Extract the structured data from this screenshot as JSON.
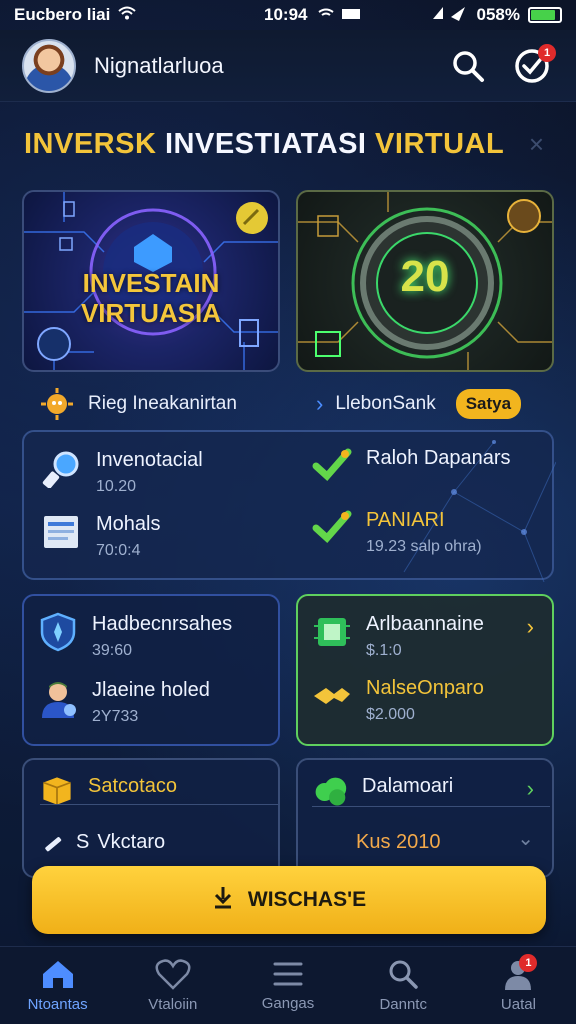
{
  "status_bar": {
    "carrier": "Eucbero liai",
    "time": "10:94",
    "battery_text": "058%",
    "battery_level": 0.85,
    "battery_color": "#47d14a"
  },
  "header": {
    "username": "Nignatlarluoa",
    "search_icon": "search-icon",
    "check_icon": "check-circle-icon",
    "notification_badge": "1"
  },
  "title": {
    "part1": "INVERSK ",
    "part2": "INVESTIATASI ",
    "part3": "VIRTUAL",
    "close_label": "×"
  },
  "banners": {
    "left_text_line1": "INVESTAIN",
    "left_text_line2": "VIRTUASIA",
    "right_number": "20"
  },
  "links": {
    "left_label": "Rieg Ineakanirtan",
    "right_label": "LlebonSank",
    "right_pill": "Satya"
  },
  "summary_panel": {
    "items": [
      {
        "title": "Invenotacial",
        "sub": "10.20"
      },
      {
        "title": "Raloh Dapanars",
        "sub": ""
      },
      {
        "title": "Mohals",
        "sub": "70:0:4"
      },
      {
        "title": "PANIARI",
        "sub": "19.23 salp ohra)"
      }
    ]
  },
  "cards": {
    "card1": {
      "item1_title": "Hadbecnrsahes",
      "item1_sub": "39:60",
      "item2_title": "Jlaeine holed",
      "item2_sub": "2Y733"
    },
    "card2": {
      "item1_title": "Arlbaannaine",
      "item1_sub": "$.1:0",
      "item2_title": "NalseOnparo",
      "item2_sub": "$2.000"
    },
    "card3": {
      "item1_title": "Satcotaco",
      "item2_title": "Vkctaro",
      "item2_prefix": "S"
    },
    "card4": {
      "item1_title": "Dalamoari",
      "item2_title": "Kus 2010"
    }
  },
  "cta": {
    "label": "WISCHAS'E"
  },
  "tabbar": {
    "tabs": [
      {
        "label": "Ntoantas",
        "active": true
      },
      {
        "label": "Vtaloiin",
        "active": false
      },
      {
        "label": "Gangas",
        "active": false
      },
      {
        "label": "Danntc",
        "active": false
      },
      {
        "label": "Uatal",
        "active": false,
        "badge": "1"
      }
    ]
  }
}
